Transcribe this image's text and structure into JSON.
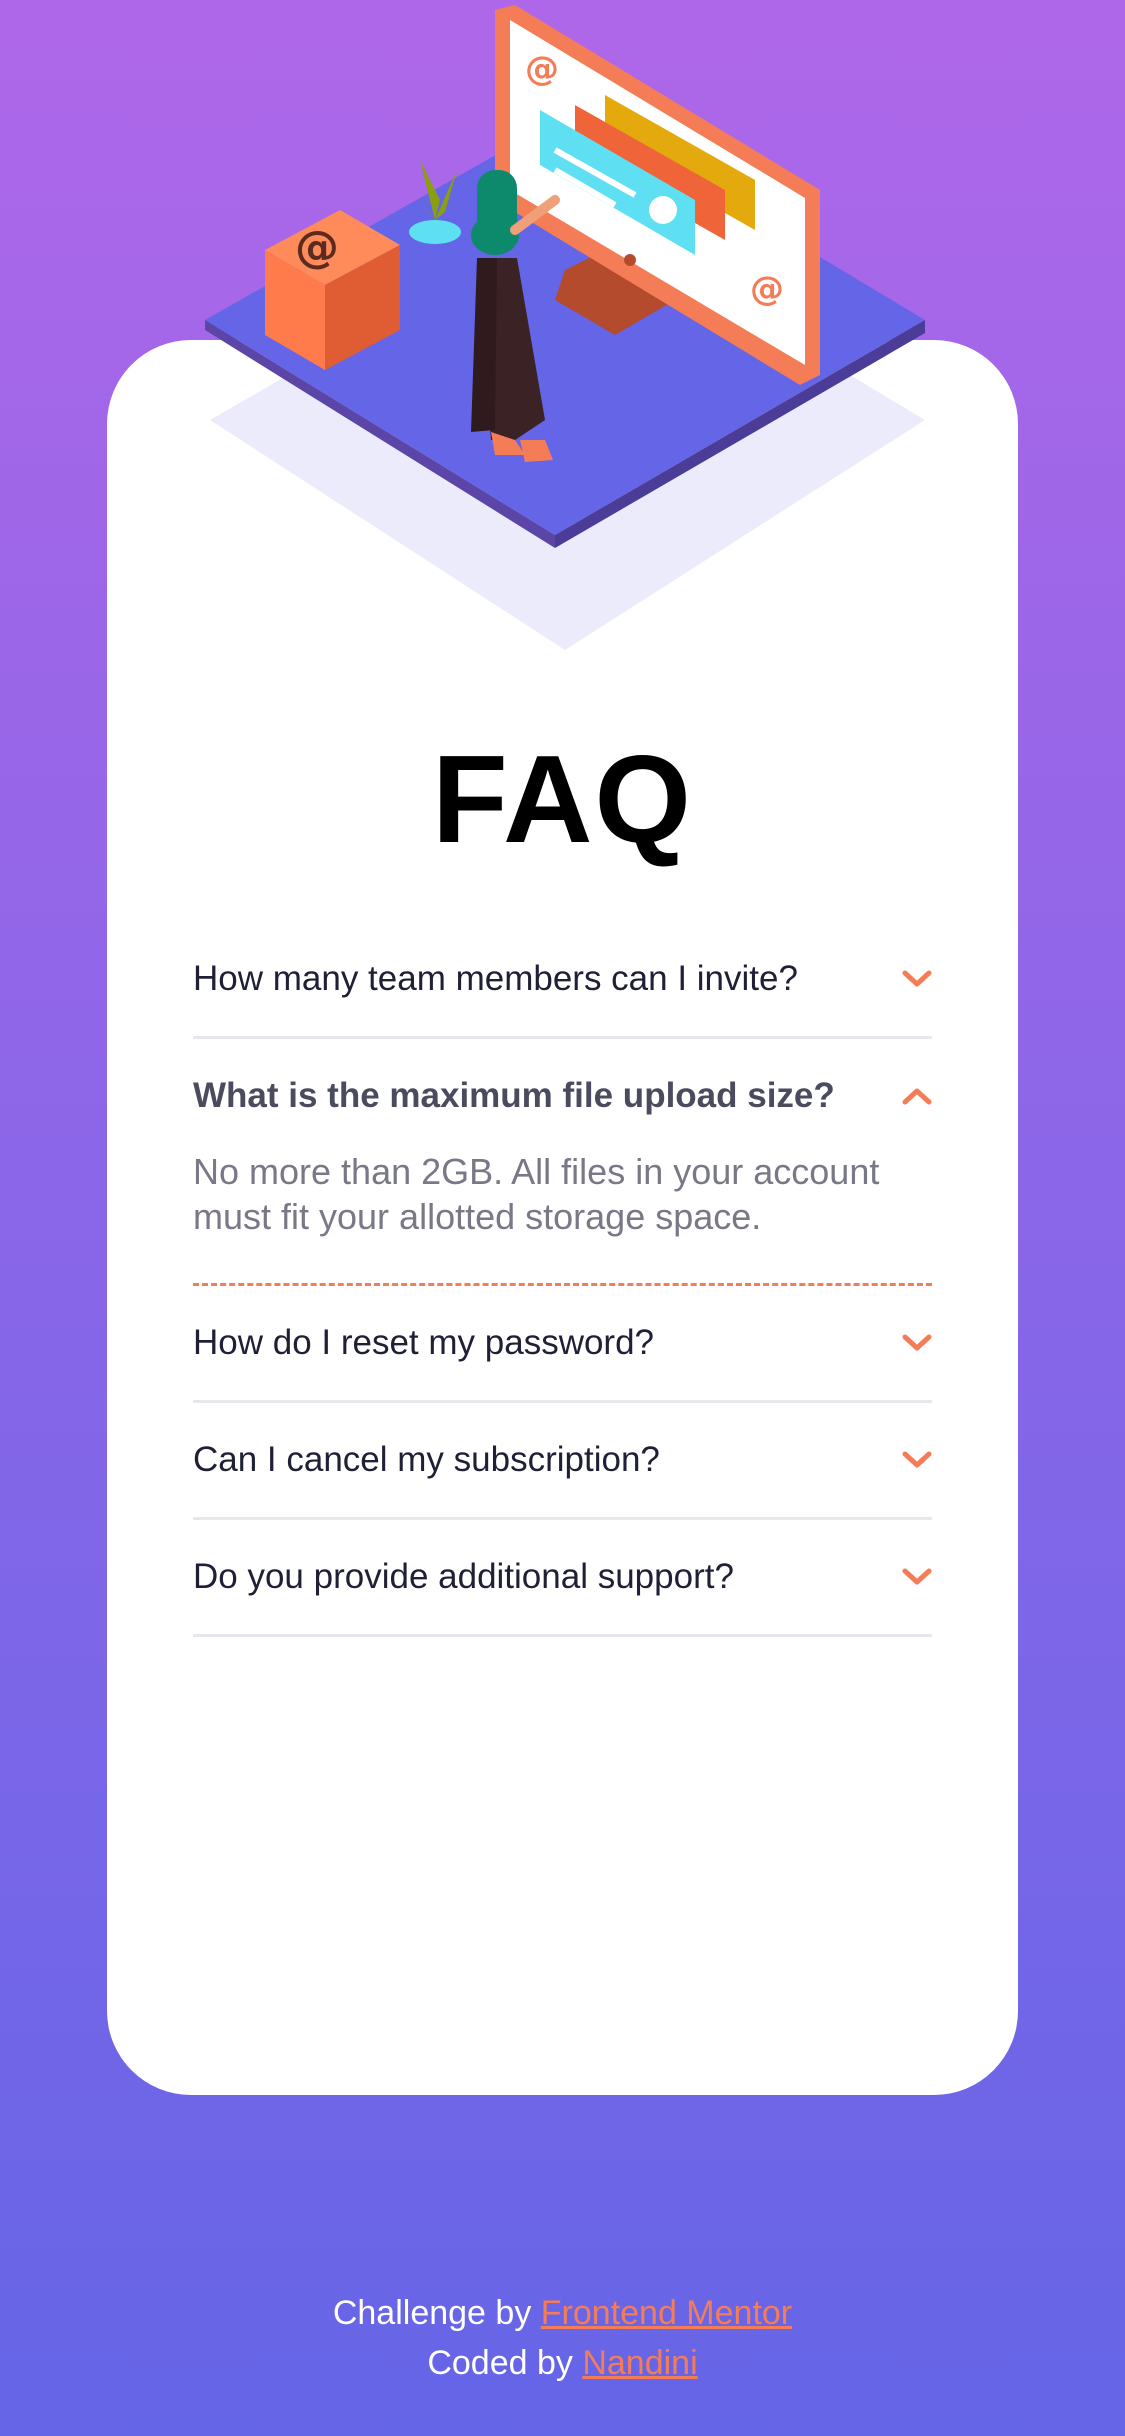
{
  "page": {
    "title": "FAQ"
  },
  "faq": {
    "items": [
      {
        "question": "How many team members can I invite?",
        "open": false
      },
      {
        "question": "What is the maximum file upload size?",
        "open": true,
        "answer": "No more than 2GB. All files in your account must fit your allotted storage space."
      },
      {
        "question": "How do I reset my password?",
        "open": false
      },
      {
        "question": "Can I cancel my subscription?",
        "open": false
      },
      {
        "question": "Do you provide additional support?",
        "open": false
      }
    ]
  },
  "footer": {
    "challenge_prefix": "Challenge by",
    "challenge_link": "Frontend Mentor",
    "coded_prefix": "Coded by",
    "coded_link": "Nandini"
  },
  "colors": {
    "bg_top": "#af67e9",
    "bg_bottom": "#6565e7",
    "accent": "#f47c57",
    "text_dark": "#1f1f36",
    "text_muted": "#787887"
  },
  "icons": {
    "collapsed": "chevron-down-icon",
    "expanded": "chevron-up-icon",
    "illustration": "woman-online-illustration"
  }
}
